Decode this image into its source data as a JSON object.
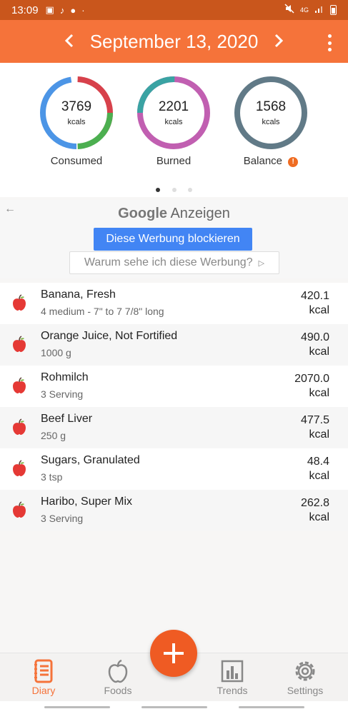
{
  "status_bar": {
    "time": "13:09",
    "network": "4G"
  },
  "header": {
    "date": "September 13, 2020"
  },
  "summary": {
    "rings": [
      {
        "value": "3769",
        "unit": "kcals",
        "label": "Consumed"
      },
      {
        "value": "2201",
        "unit": "kcals",
        "label": "Burned"
      },
      {
        "value": "1568",
        "unit": "kcals",
        "label": "Balance"
      }
    ],
    "balance_warning": "!",
    "page_count": 3,
    "active_page": 1
  },
  "ad": {
    "brand": "Google",
    "brand_suffix": "Anzeigen",
    "block_button": "Diese Werbung blockieren",
    "why_button": "Warum sehe ich diese Werbung?"
  },
  "foods": [
    {
      "name": "Banana, Fresh",
      "portion": "4 medium - 7\" to 7 7/8\" long",
      "calories": "420.1",
      "unit": "kcal"
    },
    {
      "name": "Orange Juice, Not Fortified",
      "portion": "1000 g",
      "calories": "490.0",
      "unit": "kcal"
    },
    {
      "name": "Rohmilch",
      "portion": "3 Serving",
      "calories": "2070.0",
      "unit": "kcal"
    },
    {
      "name": "Beef Liver",
      "portion": "250 g",
      "calories": "477.5",
      "unit": "kcal"
    },
    {
      "name": "Sugars, Granulated",
      "portion": "3 tsp",
      "calories": "48.4",
      "unit": "kcal"
    },
    {
      "name": "Haribo, Super Mix",
      "portion": "3 Serving",
      "calories": "262.8",
      "unit": "kcal"
    }
  ],
  "bottom_nav": {
    "diary": "Diary",
    "foods": "Foods",
    "trends": "Trends",
    "settings": "Settings"
  },
  "colors": {
    "primary": "#f5733a",
    "status_bar": "#c9561c",
    "fab": "#ef5b23",
    "ad_button": "#4285f4"
  },
  "icons": {
    "food_item": "apple-icon",
    "fab": "plus-icon",
    "nav": [
      "diary-icon",
      "apple-icon",
      "chart-icon",
      "gear-icon"
    ]
  }
}
